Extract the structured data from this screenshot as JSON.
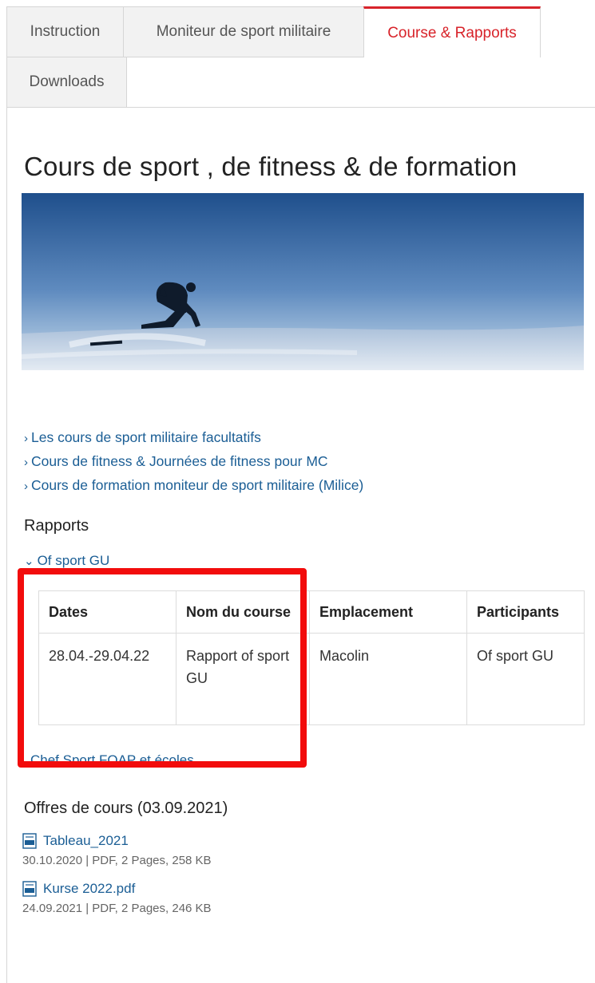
{
  "tabs": [
    {
      "label": "Instruction",
      "active": false
    },
    {
      "label": "Moniteur de sport militaire",
      "active": false
    },
    {
      "label": "Course & Rapports",
      "active": true
    },
    {
      "label": "Downloads",
      "active": false
    }
  ],
  "page": {
    "heading": "Cours de sport , de fitness & de formation"
  },
  "links": [
    "Les cours de sport militaire facultatifs",
    "Cours de fitness & Journées de fitness pour MC",
    "Cours de formation moniteur de sport militaire (Milice)"
  ],
  "rapports": {
    "title": "Rapports",
    "accordion_label": "Of sport GU",
    "table": {
      "headers": [
        "Dates",
        "Nom du course",
        "Emplacement",
        "Participants"
      ],
      "rows": [
        [
          "28.04.-29.04.22",
          "Rapport of sport GU",
          "Macolin",
          "Of sport GU"
        ]
      ]
    },
    "chef_link": "Chef Sport FOAP et écoles"
  },
  "offres": {
    "title": "Offres de cours (03.09.2021)",
    "files": [
      {
        "name": "Tableau_2021",
        "meta": "30.10.2020 | PDF, 2 Pages, 258 KB",
        "icon": "pdf-icon"
      },
      {
        "name": "Kurse 2022.pdf",
        "meta": "24.09.2021 | PDF, 2 Pages, 246 KB",
        "icon": "pdf-icon"
      }
    ]
  },
  "colors": {
    "active_tab": "#d8232a",
    "link": "#1b5e95",
    "annotation_box": "#f20c0c"
  }
}
